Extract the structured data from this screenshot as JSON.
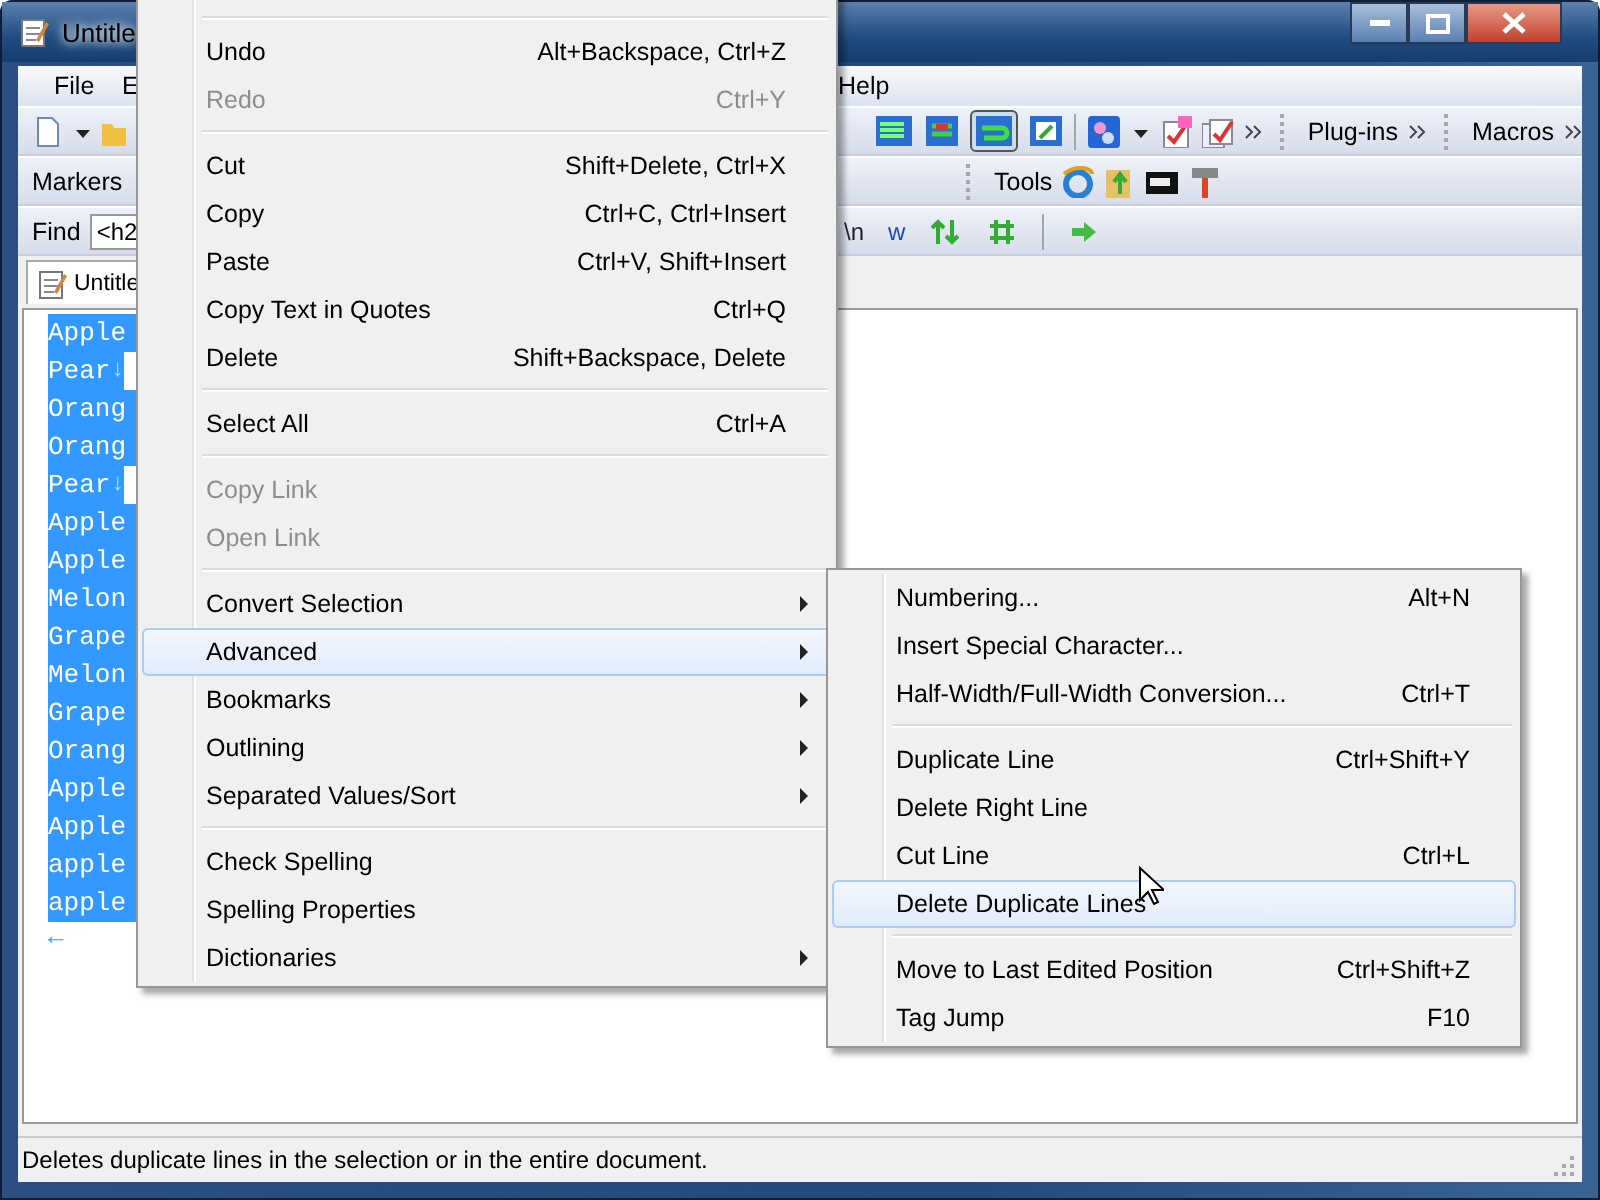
{
  "window": {
    "title": "Untitle"
  },
  "menubar": [
    {
      "label": "File"
    },
    {
      "label": "E"
    },
    {
      "label": "Help"
    }
  ],
  "toolbars": {
    "plugins_label": "Plug-ins",
    "macros_label": "Macros",
    "markers_label": "Markers",
    "tools_label": "Tools"
  },
  "find_bar": {
    "label": "Find",
    "value": "<h2",
    "buttons": [
      "\\n",
      "w"
    ]
  },
  "tab": {
    "label": "Untitle"
  },
  "editor": {
    "eof_mark": "←",
    "lines": [
      {
        "text": "Apple"
      },
      {
        "text": "Pear",
        "eol_mark": "↓"
      },
      {
        "text": "Orang"
      },
      {
        "text": "Orang"
      },
      {
        "text": "Pear",
        "eol_mark": "↓"
      },
      {
        "text": "Apple"
      },
      {
        "text": "Apple"
      },
      {
        "text": "Melon"
      },
      {
        "text": "Grape"
      },
      {
        "text": "Melon"
      },
      {
        "text": "Grape"
      },
      {
        "text": "Orang"
      },
      {
        "text": "Apple"
      },
      {
        "text": "Apple"
      },
      {
        "text": "apple"
      },
      {
        "text": "apple"
      }
    ]
  },
  "context_menu": {
    "groups": [
      [
        {
          "label": "Undo",
          "shortcut": "Alt+Backspace, Ctrl+Z",
          "disabled": false,
          "submenu": false,
          "selected": false
        },
        {
          "label": "Redo",
          "shortcut": "Ctrl+Y",
          "disabled": true,
          "submenu": false,
          "selected": false
        }
      ],
      [
        {
          "label": "Cut",
          "shortcut": "Shift+Delete, Ctrl+X",
          "disabled": false,
          "submenu": false,
          "selected": false
        },
        {
          "label": "Copy",
          "shortcut": "Ctrl+C, Ctrl+Insert",
          "disabled": false,
          "submenu": false,
          "selected": false
        },
        {
          "label": "Paste",
          "shortcut": "Ctrl+V, Shift+Insert",
          "disabled": false,
          "submenu": false,
          "selected": false
        },
        {
          "label": "Copy Text in Quotes",
          "shortcut": "Ctrl+Q",
          "disabled": false,
          "submenu": false,
          "selected": false
        },
        {
          "label": "Delete",
          "shortcut": "Shift+Backspace, Delete",
          "disabled": false,
          "submenu": false,
          "selected": false
        }
      ],
      [
        {
          "label": "Select All",
          "shortcut": "Ctrl+A",
          "disabled": false,
          "submenu": false,
          "selected": false
        }
      ],
      [
        {
          "label": "Copy Link",
          "disabled": true,
          "submenu": false,
          "selected": false
        },
        {
          "label": "Open Link",
          "disabled": true,
          "submenu": false,
          "selected": false
        }
      ],
      [
        {
          "label": "Convert Selection",
          "disabled": false,
          "submenu": true,
          "selected": false
        },
        {
          "label": "Advanced",
          "disabled": false,
          "submenu": true,
          "selected": true
        },
        {
          "label": "Bookmarks",
          "disabled": false,
          "submenu": true,
          "selected": false
        },
        {
          "label": "Outlining",
          "disabled": false,
          "submenu": true,
          "selected": false
        },
        {
          "label": "Separated Values/Sort",
          "disabled": false,
          "submenu": true,
          "selected": false
        }
      ],
      [
        {
          "label": "Check Spelling",
          "disabled": false,
          "submenu": false,
          "selected": false
        },
        {
          "label": "Spelling Properties",
          "disabled": false,
          "submenu": false,
          "selected": false
        },
        {
          "label": "Dictionaries",
          "disabled": false,
          "submenu": true,
          "selected": false
        }
      ]
    ]
  },
  "submenu": {
    "groups": [
      [
        {
          "label": "Numbering...",
          "shortcut": "Alt+N",
          "disabled": false,
          "submenu": false,
          "selected": false
        },
        {
          "label": "Insert Special Character...",
          "disabled": false,
          "submenu": false,
          "selected": false
        },
        {
          "label": "Half-Width/Full-Width Conversion...",
          "shortcut": "Ctrl+T",
          "disabled": false,
          "submenu": false,
          "selected": false
        }
      ],
      [
        {
          "label": "Duplicate Line",
          "shortcut": "Ctrl+Shift+Y",
          "disabled": false,
          "submenu": false,
          "selected": false
        },
        {
          "label": "Delete Right Line",
          "disabled": false,
          "submenu": false,
          "selected": false
        },
        {
          "label": "Cut Line",
          "shortcut": "Ctrl+L",
          "disabled": false,
          "submenu": false,
          "selected": false
        },
        {
          "label": "Delete Duplicate Lines",
          "disabled": false,
          "submenu": false,
          "selected": true
        }
      ],
      [
        {
          "label": "Move to Last Edited Position",
          "shortcut": "Ctrl+Shift+Z",
          "disabled": false,
          "submenu": false,
          "selected": false
        },
        {
          "label": "Tag Jump",
          "shortcut": "F10",
          "disabled": false,
          "submenu": false,
          "selected": false
        }
      ]
    ]
  },
  "status_bar": "Deletes duplicate lines in the selection or in the entire document."
}
